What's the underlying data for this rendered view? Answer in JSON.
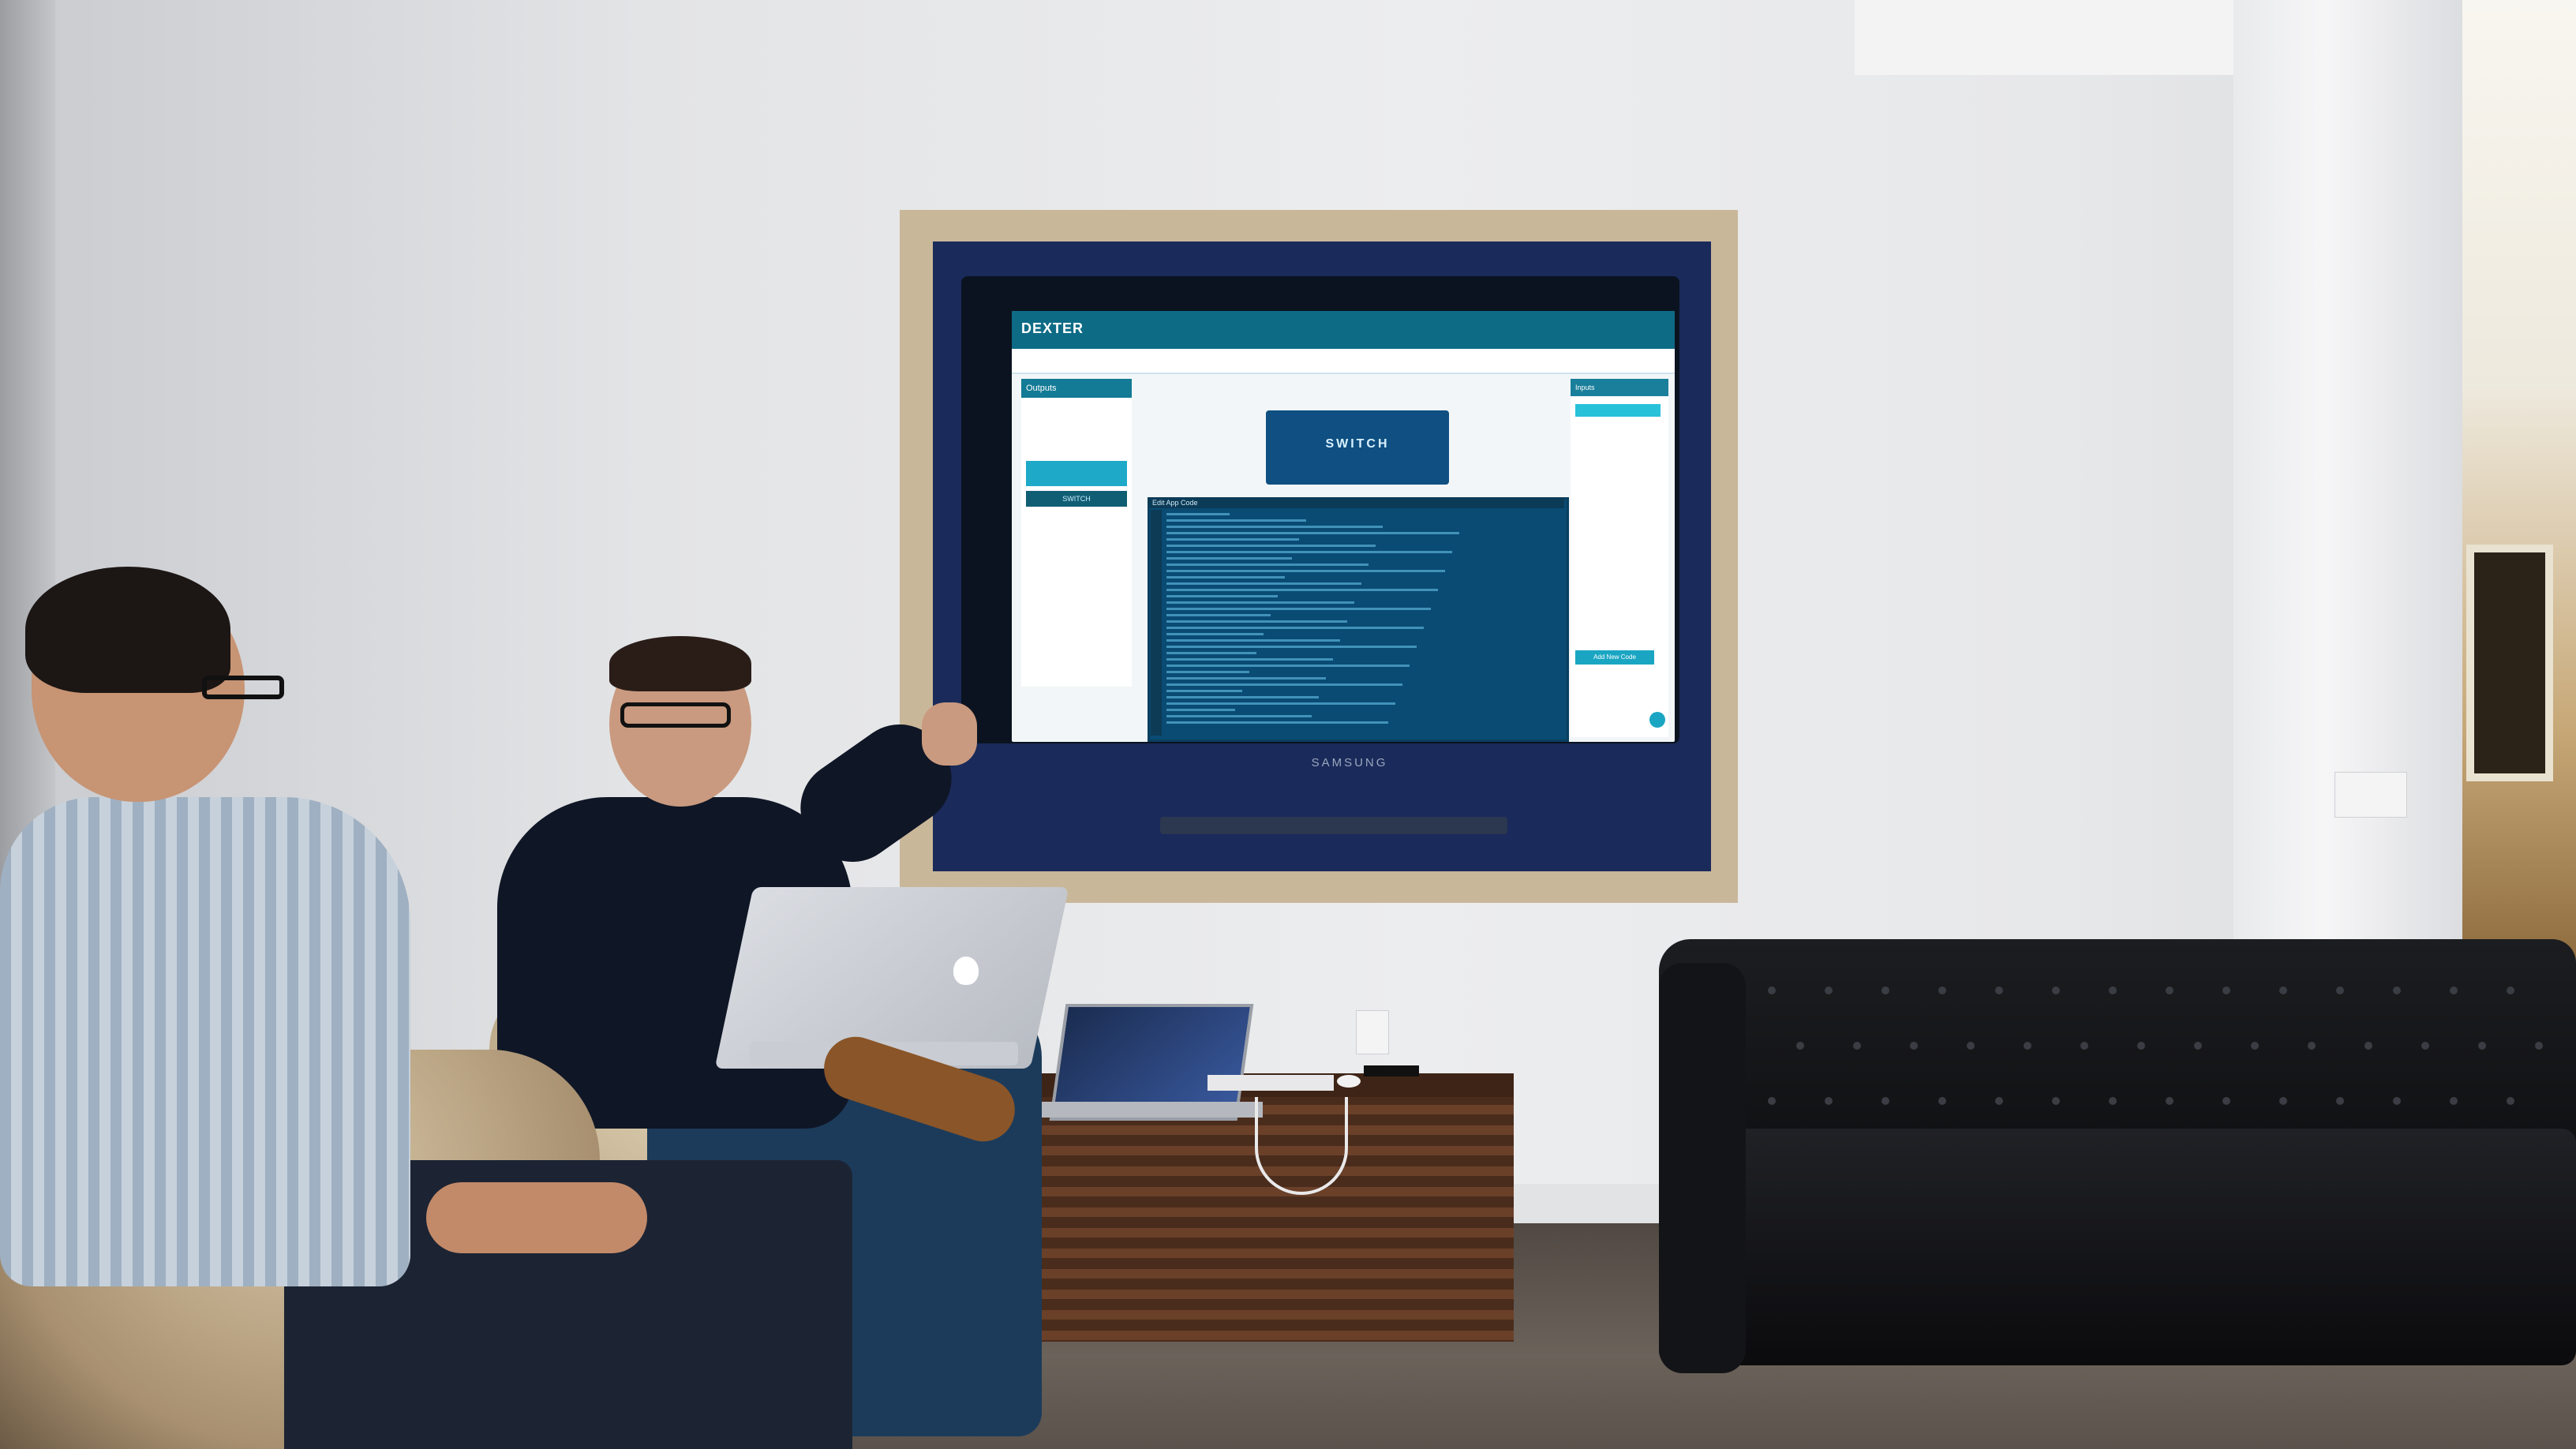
{
  "scene": {
    "description_colors": {
      "wall": "#e7e8ea",
      "tv_frame": "#c9b79a",
      "tv_surround": "#1a2a5a",
      "app_accent": "#0e6b86",
      "sofa": "#111214",
      "side_table": "#5a3622"
    }
  },
  "tv": {
    "brand": "SAMSUNG"
  },
  "screen_app": {
    "logo": "DEXTER",
    "left_header": "Outputs",
    "left_tile": "",
    "left_switch_label": "SWITCH",
    "switch_block_label": "SWITCH",
    "editor_title": "Edit App Code",
    "right_header": "Inputs",
    "right_bottom_button": "Add New Code",
    "code_line_count": 34
  }
}
